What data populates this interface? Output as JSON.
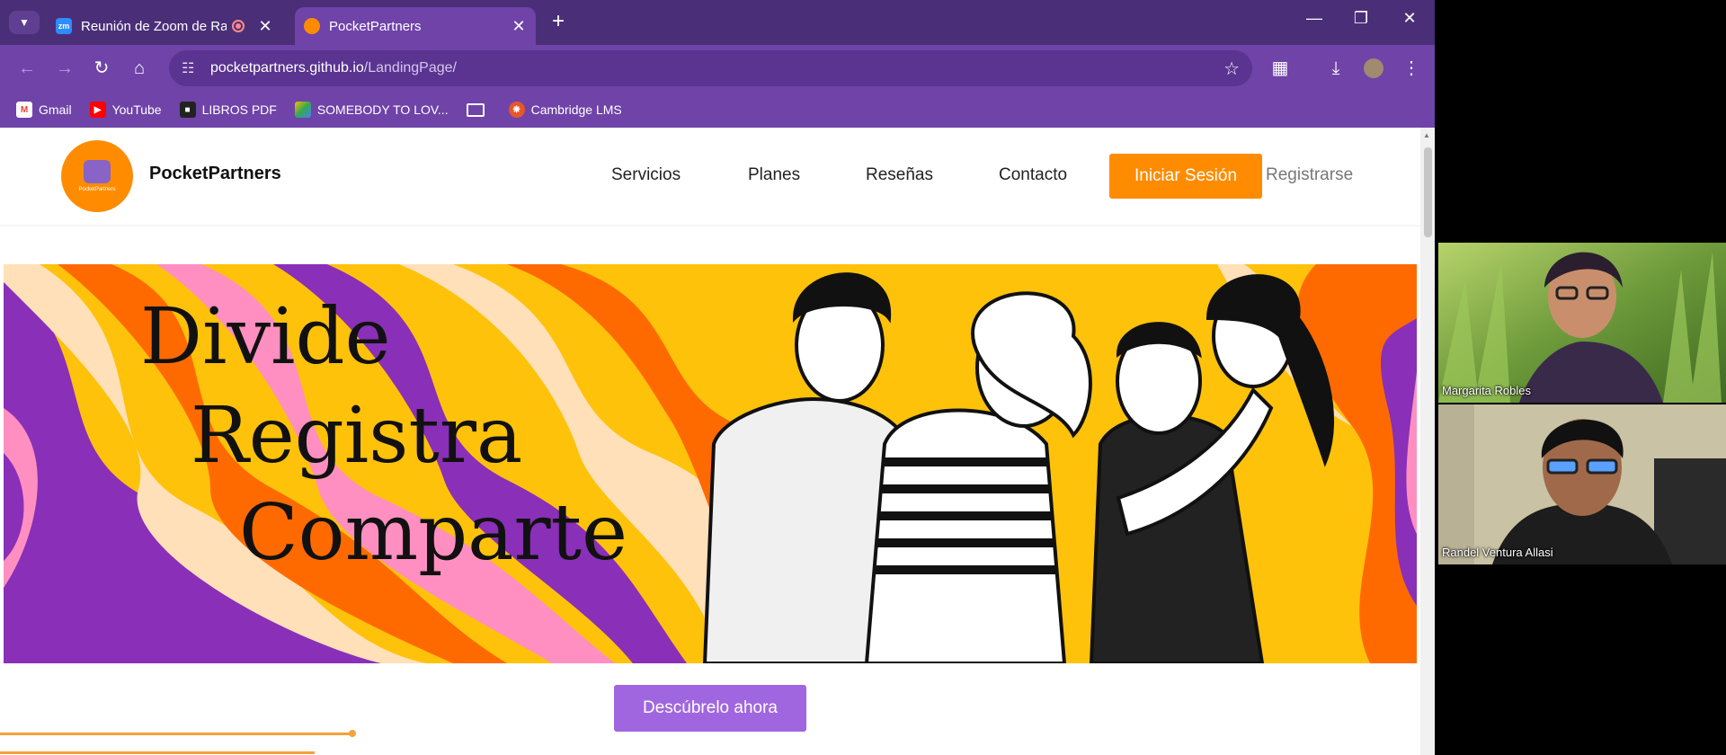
{
  "browser": {
    "tabs": [
      {
        "title": "Reunión de Zoom de Rande",
        "favicon": "zoom-icon",
        "recording": true
      },
      {
        "title": "PocketPartners",
        "favicon": "pocketpartners-icon",
        "active": true
      }
    ],
    "new_tab": "+",
    "url_host": "pocketpartners.github.io",
    "url_path": "/LandingPage/",
    "bookmarks": [
      {
        "label": "Gmail",
        "icon": "gmail-icon",
        "color": "#ea4335"
      },
      {
        "label": "YouTube",
        "icon": "youtube-icon",
        "color": "#ff0000"
      },
      {
        "label": "LIBROS PDF",
        "icon": "bookmark-book-icon",
        "color": "#222222"
      },
      {
        "label": "SOMEBODY TO LOV...",
        "icon": "drive-icon",
        "color": "#34a853"
      },
      {
        "label": "",
        "icon": "folder-icon",
        "color": "#ffffff"
      },
      {
        "label": "Cambridge LMS",
        "icon": "cambridge-icon",
        "color": "#e8562a"
      }
    ]
  },
  "site": {
    "brand": "PocketPartners",
    "logo_text": "PocketPartners",
    "nav": [
      "Servicios",
      "Planes",
      "Reseñas",
      "Contacto"
    ],
    "login": "Iniciar Sesión",
    "register": "Registrarse",
    "hero_lines": [
      "Divide",
      "Registra",
      "Comparte"
    ],
    "cta": "Descúbrelo ahora",
    "colors": {
      "primary": "#ff8c00",
      "cta": "#a066e0",
      "purple": "#8a2fb8",
      "yellow": "#ffc20a",
      "pink": "#ff8fc0"
    }
  },
  "zoom": {
    "participants": [
      {
        "name": "Margarita Robles"
      },
      {
        "name": "Randel Ventura Allasi"
      }
    ]
  }
}
